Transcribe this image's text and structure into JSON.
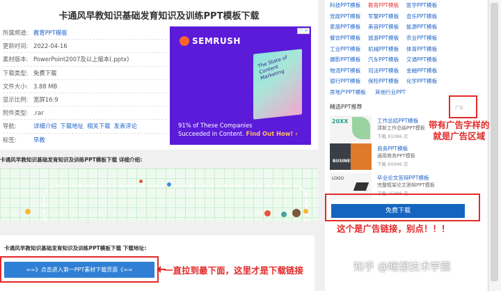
{
  "main": {
    "title": "卡通风早教知识基础发育知识及训练PPT模板下载",
    "meta": [
      {
        "key": "所属频道:",
        "value": "教育PPT模板",
        "link": true
      },
      {
        "key": "更新时间:",
        "value": "2022-04-16"
      },
      {
        "key": "素材版本:",
        "value": "PowerPoint2007及以上版本(.pptx)"
      },
      {
        "key": "下载类型:",
        "value": "免费下载"
      },
      {
        "key": "文件大小:",
        "value": "3.88 MB"
      },
      {
        "key": "显示比例:",
        "value": "宽屏16:9"
      },
      {
        "key": "附件类型:",
        "value": ".rar"
      }
    ],
    "nav_key": "导航:",
    "nav_links": [
      "详细介绍",
      "下载地址",
      "相关下载",
      "发表评论"
    ],
    "tag_key": "标签:",
    "tag_value": "早教",
    "section_heading": "卡通风早教知识基础发育知识及训练PPT模板下载 详细介绍:",
    "download_label": "卡通风早教知识基础发育知识及训练PPT模板下载 下载地址:",
    "download_button": "==》点击进入第一PPT素材下载页面《=="
  },
  "ad": {
    "brand": "SEMRUSH",
    "close": "ⓘ ✕",
    "book_text": "The State of Content Marketing",
    "line1": "91% of These Companies",
    "line2_plain": "Succeeded in Content.",
    "line2_cta": "Find Out How! ›"
  },
  "sidebar": {
    "categories": [
      [
        "科技PPT模板",
        "教育PPT模板",
        "医学PPT模板"
      ],
      [
        "党政PPT模板",
        "军警PPT模板",
        "音乐PPT模板"
      ],
      [
        "家居PPT模板",
        "美容PPT模板",
        "能源PPT模板"
      ],
      [
        "餐饮PPT模板",
        "旅游PPT模板",
        "农业PPT模板"
      ],
      [
        "工业PPT模板",
        "机械PPT模板",
        "体育PPT模板"
      ],
      [
        "摄影PPT模板",
        "汽车PPT模板",
        "交通PPT模板"
      ],
      [
        "物流PPT模板",
        "司法PPT模板",
        "金融PPT模板"
      ],
      [
        "银行PPT模板",
        "保险PPT模板",
        "化学PPT模板"
      ],
      [
        "房地产PPT模板",
        "其他行业PPT",
        ""
      ]
    ],
    "highlight_category": "教育PPT模板",
    "reco_heading": "精选PPT推荐",
    "ad_tag": "广告",
    "recos": [
      {
        "title": "工作总结PPT模板",
        "desc": "清新工作总结PPT模板",
        "count": "下载 81086 次",
        "thumb_text": "20XX"
      },
      {
        "title": "商务PPT模板",
        "desc": "通用商务PPT模板",
        "count": "下载 60096 次",
        "thumb_text": "BUSINESS"
      },
      {
        "title": "毕业论文答辩PPT模板",
        "desc": "完整框架论文答辩PPT模板",
        "count": "下载 15086 次",
        "thumb_text": "LOGO"
      }
    ],
    "free_download": "免费下载"
  },
  "annotations": {
    "ad_area": "带有广告字样的\n就是广告区域",
    "ad_link": "这个是广告链接，别点！！！",
    "real_link": "一直拉到最下面，这里才是下载链接"
  },
  "watermark": "知乎 @瞎想技术学霸",
  "colors": {
    "link": "#1f64c6",
    "annotation_red": "#e32929",
    "download_blue": "#2f7fd4",
    "ad_purple": "#5b1bd9"
  }
}
